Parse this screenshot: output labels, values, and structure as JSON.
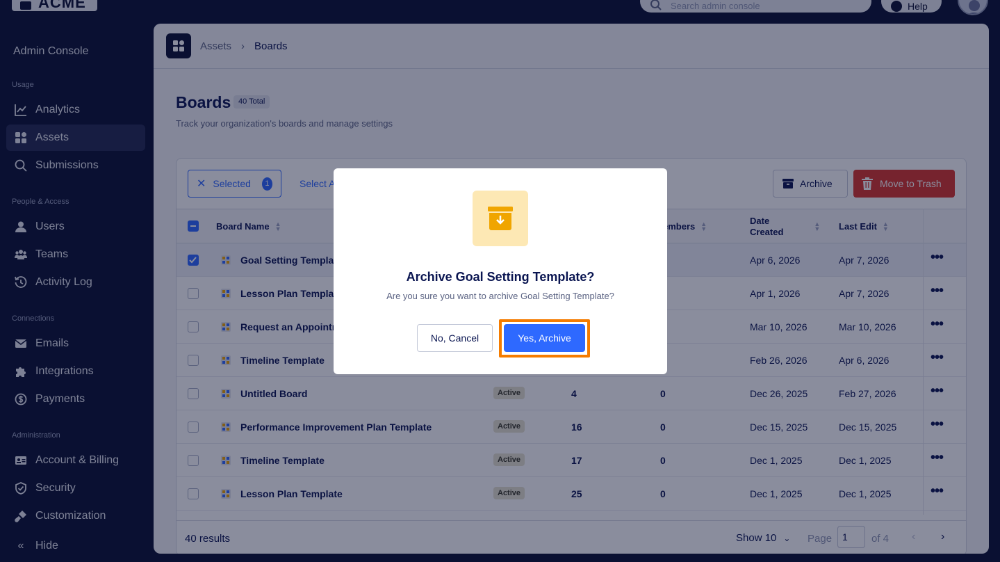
{
  "topbar": {
    "logo_text": "ACME",
    "search_placeholder": "Search admin console",
    "help_label": "Help"
  },
  "sidebar": {
    "title": "Admin Console",
    "sections": [
      {
        "label": "Usage",
        "items": [
          {
            "label": "Analytics",
            "icon": "chart-icon"
          },
          {
            "label": "Assets",
            "icon": "grid-icon",
            "active": true
          },
          {
            "label": "Submissions",
            "icon": "search-icon"
          }
        ]
      },
      {
        "label": "People & Access",
        "items": [
          {
            "label": "Users",
            "icon": "user-icon"
          },
          {
            "label": "Teams",
            "icon": "team-icon"
          },
          {
            "label": "Activity Log",
            "icon": "history-icon"
          }
        ]
      },
      {
        "label": "Connections",
        "items": [
          {
            "label": "Emails",
            "icon": "mail-icon"
          },
          {
            "label": "Integrations",
            "icon": "puzzle-icon"
          },
          {
            "label": "Payments",
            "icon": "payment-icon"
          }
        ]
      },
      {
        "label": "Administration",
        "items": [
          {
            "label": "Account & Billing",
            "icon": "id-card-icon"
          },
          {
            "label": "Security",
            "icon": "shield-icon"
          },
          {
            "label": "Customization",
            "icon": "paint-icon"
          }
        ]
      }
    ],
    "hide_label": "Hide"
  },
  "breadcrumb": {
    "parent": "Assets",
    "current": "Boards"
  },
  "page": {
    "title": "Boards",
    "total_badge": "40 Total",
    "subtitle": "Track your organization's boards and manage settings"
  },
  "toolbar": {
    "selected_label": "Selected",
    "selected_count": "1",
    "select_all_label": "Select A",
    "archive_label": "Archive",
    "trash_label": "Move to Trash"
  },
  "table": {
    "columns": {
      "board_name": "Board Name",
      "members": "Members",
      "members_visible": "embers",
      "date_created_1": "Date",
      "date_created_2": "Created",
      "last_edit": "Last Edit"
    },
    "rows": [
      {
        "name": "Goal Setting Template",
        "name_visible": "Goal Setting Templat",
        "status": "",
        "c1": "",
        "c2": "",
        "created": "Apr 6, 2026",
        "edited": "Apr 7, 2026",
        "selected": true
      },
      {
        "name": "Lesson Plan Template",
        "name_visible": "Lesson Plan Template",
        "status": "",
        "c1": "",
        "c2": "",
        "created": "Apr 1, 2026",
        "edited": "Apr 7, 2026",
        "selected": false
      },
      {
        "name": "Request an Appointment",
        "name_visible": "Request an Appointm",
        "status": "",
        "c1": "",
        "c2": "",
        "created": "Mar 10, 2026",
        "edited": "Mar 10, 2026",
        "selected": false
      },
      {
        "name": "Timeline Template",
        "name_visible": "Timeline Template",
        "status": "",
        "c1": "",
        "c2": "",
        "created": "Feb 26, 2026",
        "edited": "Apr 6, 2026",
        "selected": false
      },
      {
        "name": "Untitled Board",
        "name_visible": "Untitled Board",
        "status": "Active",
        "c1": "4",
        "c2": "0",
        "created": "Dec 26, 2025",
        "edited": "Feb 27, 2026",
        "selected": false
      },
      {
        "name": "Performance Improvement Plan Template",
        "name_visible": "Performance Improvement Plan Template",
        "status": "Active",
        "c1": "16",
        "c2": "0",
        "created": "Dec 15, 2025",
        "edited": "Dec 15, 2025",
        "selected": false
      },
      {
        "name": "Timeline Template",
        "name_visible": "Timeline Template",
        "status": "Active",
        "c1": "17",
        "c2": "0",
        "created": "Dec 1, 2025",
        "edited": "Dec 1, 2025",
        "selected": false
      },
      {
        "name": "Lesson Plan Template",
        "name_visible": "Lesson Plan Template",
        "status": "Active",
        "c1": "25",
        "c2": "0",
        "created": "Dec 1, 2025",
        "edited": "Dec 1, 2025",
        "selected": false
      }
    ]
  },
  "footer": {
    "results": "40 results",
    "show": "Show 10",
    "page_label": "Page",
    "page_value": "1",
    "of_label": "of 4"
  },
  "modal": {
    "title": "Archive Goal Setting Template?",
    "message": "Are you sure you want to archive Goal Setting Template?",
    "cancel_label": "No, Cancel",
    "confirm_label": "Yes, Archive",
    "icon": "archive-box-icon"
  },
  "colors": {
    "accent": "#2e69ff",
    "danger": "#d9342b",
    "highlight": "#f57c00",
    "sidebar_bg": "#0a1033"
  }
}
